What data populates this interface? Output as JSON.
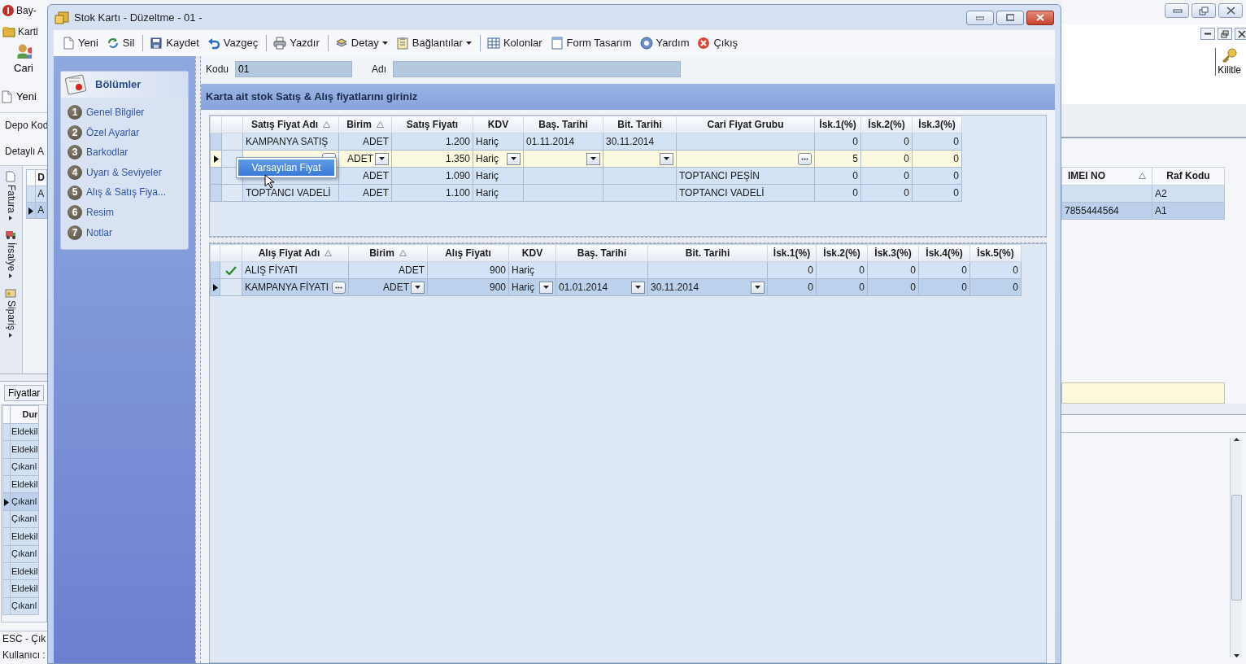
{
  "background_app": {
    "title": "Bay-",
    "menu": "Kartl",
    "buttons": [
      {
        "label": "Cari",
        "kind": "contacts"
      },
      {
        "label": "Yeni",
        "kind": "new"
      }
    ],
    "fields": [
      "Depo Kod",
      "Detaylı A"
    ],
    "side_tabs": [
      "Fatura",
      "İrsalye",
      "Sipariş"
    ],
    "mini_grid": {
      "column": "D",
      "rows": [
        {
          "value": "A",
          "selected": false
        },
        {
          "value": "A",
          "selected": true
        }
      ]
    },
    "tab": "Fiyatlar",
    "grid": {
      "column": "Dur",
      "rows": [
        {
          "value": "Eldekil",
          "selected": false
        },
        {
          "value": "Eldekil",
          "selected": false
        },
        {
          "value": "Çıkanl",
          "selected": false
        },
        {
          "value": "Eldekil",
          "selected": false
        },
        {
          "value": "Çıkanl",
          "selected": true
        },
        {
          "value": "Çıkanl",
          "selected": false
        },
        {
          "value": "Eldekil",
          "selected": false
        },
        {
          "value": "Çıkanl",
          "selected": false
        },
        {
          "value": "Eldekil",
          "selected": false
        },
        {
          "value": "Eldekil",
          "selected": false
        },
        {
          "value": "Çıkanl",
          "selected": false
        }
      ]
    },
    "status": [
      "ESC - Çık",
      "Kullanıcı :"
    ],
    "lock_button": "Kilitle",
    "right_grid": {
      "columns": [
        {
          "label": "IMEI NO",
          "sorted": true
        },
        {
          "label": "Raf Kodu",
          "sorted": false
        }
      ],
      "rows": [
        {
          "cells": [
            null,
            "A2"
          ],
          "selected": false
        },
        {
          "cells": [
            "7855444564",
            "A1"
          ],
          "selected": true
        }
      ]
    }
  },
  "dialog": {
    "title": "Stok Kartı - Düzeltme - 01 -",
    "toolbar": [
      {
        "label": "Yeni",
        "kind": "new",
        "dropdown": false,
        "separator_before": false
      },
      {
        "label": "Sil",
        "kind": "delete",
        "dropdown": false,
        "separator_before": false
      },
      {
        "label": "Kaydet",
        "kind": "save",
        "dropdown": false,
        "separator_before": true
      },
      {
        "label": "Vazgeç",
        "kind": "undo",
        "dropdown": false,
        "separator_before": false
      },
      {
        "label": "Yazdır",
        "kind": "print",
        "dropdown": false,
        "separator_before": true
      },
      {
        "label": "Detay",
        "kind": "detail",
        "dropdown": true,
        "separator_before": true
      },
      {
        "label": "Bağlantılar",
        "kind": "links",
        "dropdown": true,
        "separator_before": false
      },
      {
        "label": "Kolonlar",
        "kind": "columns",
        "dropdown": false,
        "separator_before": true
      },
      {
        "label": "Form Tasarım",
        "kind": "form",
        "dropdown": false,
        "separator_before": false
      },
      {
        "label": "Yardım",
        "kind": "help",
        "dropdown": false,
        "separator_before": false
      },
      {
        "label": "Çıkış",
        "kind": "exit",
        "dropdown": false,
        "separator_before": false
      }
    ],
    "sections": {
      "title": "Bölümler",
      "items": [
        {
          "number": "1",
          "label": "Genel Bilgiler"
        },
        {
          "number": "2",
          "label": "Özel Ayarlar"
        },
        {
          "number": "3",
          "label": "Barkodlar"
        },
        {
          "number": "4",
          "label": "Uyarı & Seviyeler"
        },
        {
          "number": "5",
          "label": "Alış & Satış Fiya..."
        },
        {
          "number": "6",
          "label": "Resim"
        },
        {
          "number": "7",
          "label": "Notlar"
        }
      ]
    },
    "code": {
      "label": "Kodu",
      "value": "01"
    },
    "name": {
      "label": "Adı"
    },
    "banner": "Karta ait stok Satış & Alış fiyatlarını giriniz",
    "sales_grid": {
      "focused": true,
      "columns": [
        {
          "label": "Satış Fiyat Adı",
          "sorted": true,
          "kind": "lookup"
        },
        {
          "label": "Birim",
          "sorted": true,
          "kind": "combo"
        },
        {
          "label": "Satış Fiyatı",
          "sorted": false,
          "kind": "text"
        },
        {
          "label": "KDV",
          "sorted": false,
          "kind": "combo"
        },
        {
          "label": "Baş. Tarihi",
          "sorted": false,
          "kind": "combo"
        },
        {
          "label": "Bit. Tarihi",
          "sorted": false,
          "kind": "combo"
        },
        {
          "label": "Cari Fiyat Grubu",
          "sorted": false,
          "kind": "lookup"
        },
        {
          "label": "İsk.1(%)",
          "sorted": false,
          "kind": "text"
        },
        {
          "label": "İsk.2(%)",
          "sorted": false,
          "kind": "text"
        },
        {
          "label": "İsk.3(%)",
          "sorted": false,
          "kind": "text"
        }
      ],
      "rows": [
        {
          "selected": false,
          "default": false,
          "cells": [
            "KAMPANYA SATIŞ",
            "ADET",
            "1.200",
            "Hariç",
            "01.11.2014",
            "30.11.2014",
            null,
            "0",
            "0",
            "0"
          ]
        },
        {
          "selected": true,
          "default": false,
          "cells": [
            null,
            "ADET",
            "1.350",
            "Hariç",
            null,
            null,
            null,
            "5",
            "0",
            "0"
          ]
        },
        {
          "selected": false,
          "default": false,
          "cells": [
            null,
            "ADET",
            "1.090",
            "Hariç",
            null,
            null,
            "TOPTANCI PEŞİN",
            "0",
            "0",
            "0"
          ]
        },
        {
          "selected": false,
          "default": false,
          "cells": [
            "TOPTANCI VADELİ",
            "ADET",
            "1.100",
            "Hariç",
            null,
            null,
            "TOPTANCI VADELİ",
            "0",
            "0",
            "0"
          ]
        }
      ],
      "popup_menu": [
        {
          "label": "Varsayılan Fiyat",
          "selected": true
        }
      ]
    },
    "purchase_grid": {
      "focused": false,
      "columns": [
        {
          "label": "Alış Fiyat Adı",
          "sorted": true,
          "kind": "lookup"
        },
        {
          "label": "Birim",
          "sorted": true,
          "kind": "combo"
        },
        {
          "label": "Alış Fiyatı",
          "sorted": false,
          "kind": "text"
        },
        {
          "label": "KDV",
          "sorted": false,
          "kind": "combo"
        },
        {
          "label": "Baş. Tarihi",
          "sorted": false,
          "kind": "combo"
        },
        {
          "label": "Bit. Tarihi",
          "sorted": false,
          "kind": "combo"
        },
        {
          "label": "İsk.1(%)",
          "sorted": false,
          "kind": "text"
        },
        {
          "label": "İsk.2(%)",
          "sorted": false,
          "kind": "text"
        },
        {
          "label": "İsk.3(%)",
          "sorted": false,
          "kind": "text"
        },
        {
          "label": "İsk.4(%)",
          "sorted": false,
          "kind": "text"
        },
        {
          "label": "İsk.5(%)",
          "sorted": false,
          "kind": "text"
        }
      ],
      "rows": [
        {
          "selected": false,
          "default": true,
          "cells": [
            "ALIŞ FİYATI",
            "ADET",
            "900",
            "Hariç",
            null,
            null,
            "0",
            "0",
            "0",
            "0",
            "0"
          ]
        },
        {
          "selected": true,
          "default": false,
          "cells": [
            "KAMPANYA FİYATI",
            "ADET",
            "900",
            "Hariç",
            "01.01.2014",
            "30.11.2014",
            "0",
            "0",
            "0",
            "0",
            "0"
          ]
        }
      ]
    }
  }
}
